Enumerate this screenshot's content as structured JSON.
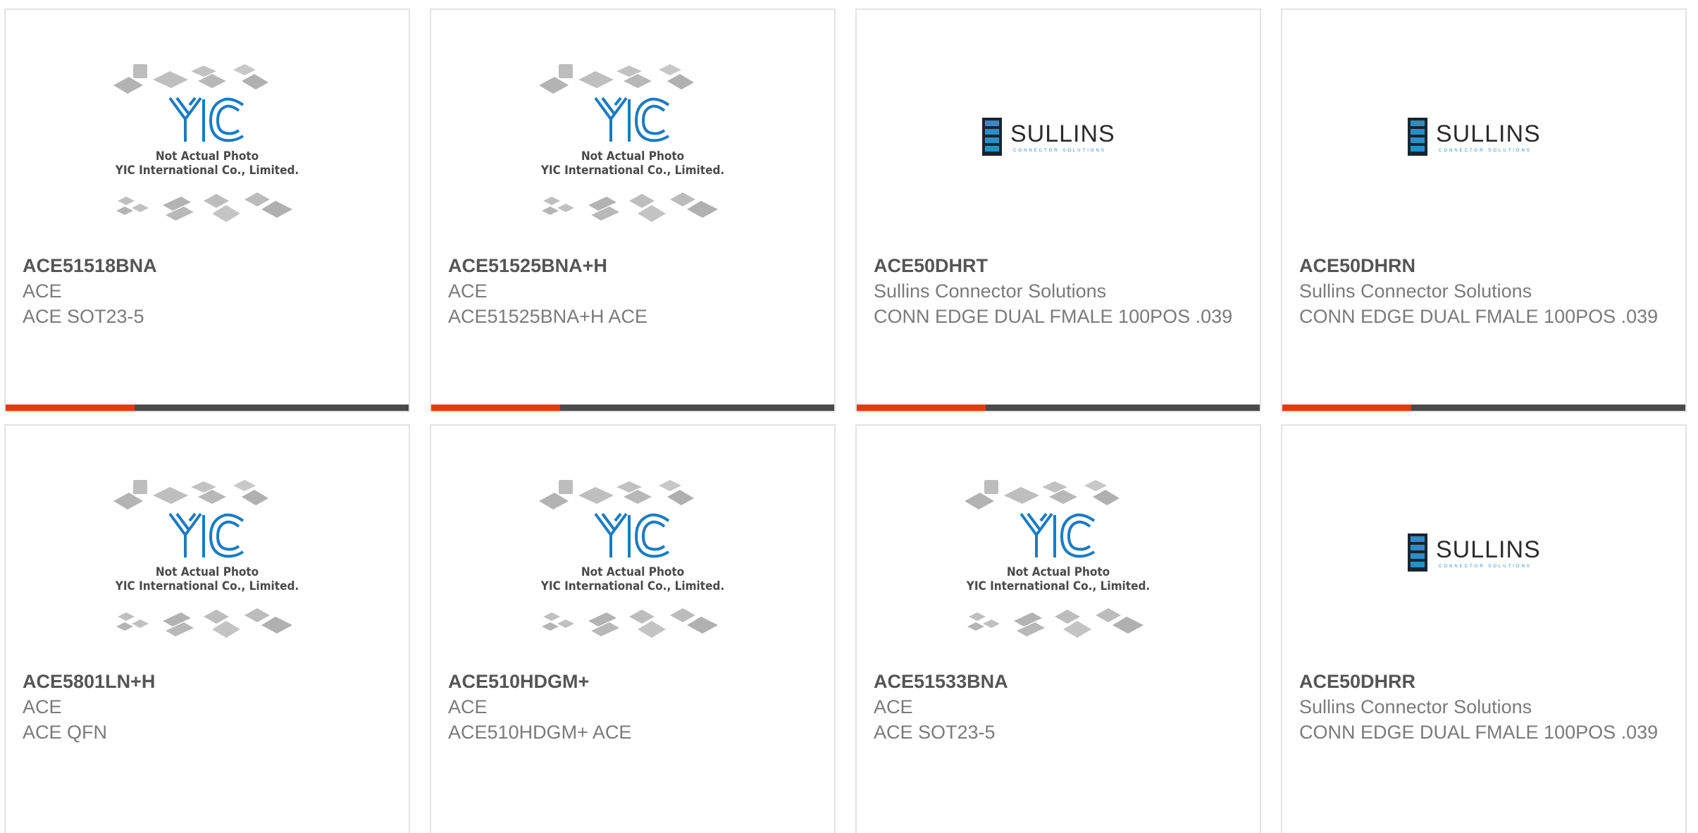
{
  "products": [
    {
      "part": "ACE51518BNA",
      "brand": "ACE",
      "desc": "ACE SOT23-5",
      "image": "yic-placeholder"
    },
    {
      "part": "ACE51525BNA+H",
      "brand": "ACE",
      "desc": "ACE51525BNA+H ACE",
      "image": "yic-placeholder"
    },
    {
      "part": "ACE50DHRT",
      "brand": "Sullins Connector Solutions",
      "desc": "CONN EDGE DUAL FMALE 100POS .039",
      "image": "sullins-logo"
    },
    {
      "part": "ACE50DHRN",
      "brand": "Sullins Connector Solutions",
      "desc": "CONN EDGE DUAL FMALE 100POS .039",
      "image": "sullins-logo"
    },
    {
      "part": "ACE5801LN+H",
      "brand": "ACE",
      "desc": "ACE QFN",
      "image": "yic-placeholder"
    },
    {
      "part": "ACE510HDGM+",
      "brand": "ACE",
      "desc": "ACE510HDGM+ ACE",
      "image": "yic-placeholder"
    },
    {
      "part": "ACE51533BNA",
      "brand": "ACE",
      "desc": "ACE SOT23-5",
      "image": "yic-placeholder"
    },
    {
      "part": "ACE50DHRR",
      "brand": "Sullins Connector Solutions",
      "desc": "CONN EDGE DUAL FMALE 100POS .039",
      "image": "sullins-logo"
    }
  ],
  "yic_placeholder": {
    "logo_text": "YIC",
    "line1": "Not Actual Photo",
    "line2": "YIC International Co., Limited."
  },
  "sullins_logo": {
    "name": "SULLINS",
    "tagline": "CONNECTOR SOLUTIONS"
  },
  "colors": {
    "accent": "#e8390e",
    "bar": "#4a4a4a",
    "yic_blue": "#1a7bc4",
    "sullins_blue": "#2a8fc7"
  }
}
